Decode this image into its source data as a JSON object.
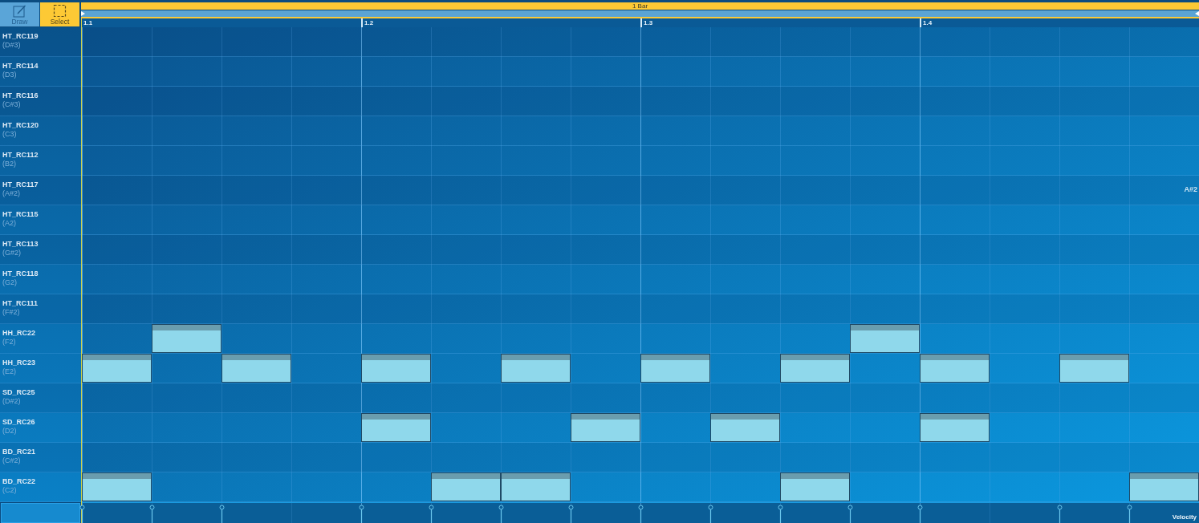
{
  "toolbar": {
    "tools": [
      {
        "kind": "draw",
        "label": "Draw",
        "selected": false
      },
      {
        "kind": "select",
        "label": "Select",
        "selected": true
      }
    ]
  },
  "ruler": {
    "region_label": "1 Bar",
    "markers": [
      "1.1",
      "1.2",
      "1.3",
      "1.4"
    ]
  },
  "rows": [
    {
      "name": "HT_RC119",
      "pitch": "(D#3)",
      "kind": "sharp",
      "steps": [
        {
          "kind": "rest"
        },
        {
          "kind": "rest"
        },
        {
          "kind": "rest"
        },
        {
          "kind": "rest"
        },
        {
          "kind": "rest"
        },
        {
          "kind": "rest"
        },
        {
          "kind": "rest"
        },
        {
          "kind": "rest"
        },
        {
          "kind": "rest"
        },
        {
          "kind": "rest"
        },
        {
          "kind": "rest"
        },
        {
          "kind": "rest"
        },
        {
          "kind": "rest"
        },
        {
          "kind": "rest"
        },
        {
          "kind": "rest"
        },
        {
          "kind": "rest"
        }
      ]
    },
    {
      "name": "HT_RC114",
      "pitch": "(D3)",
      "kind": "natural",
      "steps": [
        {
          "kind": "rest"
        },
        {
          "kind": "rest"
        },
        {
          "kind": "rest"
        },
        {
          "kind": "rest"
        },
        {
          "kind": "rest"
        },
        {
          "kind": "rest"
        },
        {
          "kind": "rest"
        },
        {
          "kind": "rest"
        },
        {
          "kind": "rest"
        },
        {
          "kind": "rest"
        },
        {
          "kind": "rest"
        },
        {
          "kind": "rest"
        },
        {
          "kind": "rest"
        },
        {
          "kind": "rest"
        },
        {
          "kind": "rest"
        },
        {
          "kind": "rest"
        }
      ]
    },
    {
      "name": "HT_RC116",
      "pitch": "(C#3)",
      "kind": "sharp",
      "steps": [
        {
          "kind": "rest"
        },
        {
          "kind": "rest"
        },
        {
          "kind": "rest"
        },
        {
          "kind": "rest"
        },
        {
          "kind": "rest"
        },
        {
          "kind": "rest"
        },
        {
          "kind": "rest"
        },
        {
          "kind": "rest"
        },
        {
          "kind": "rest"
        },
        {
          "kind": "rest"
        },
        {
          "kind": "rest"
        },
        {
          "kind": "rest"
        },
        {
          "kind": "rest"
        },
        {
          "kind": "rest"
        },
        {
          "kind": "rest"
        },
        {
          "kind": "rest"
        }
      ]
    },
    {
      "name": "HT_RC120",
      "pitch": "(C3)",
      "kind": "natural",
      "steps": [
        {
          "kind": "rest"
        },
        {
          "kind": "rest"
        },
        {
          "kind": "rest"
        },
        {
          "kind": "rest"
        },
        {
          "kind": "rest"
        },
        {
          "kind": "rest"
        },
        {
          "kind": "rest"
        },
        {
          "kind": "rest"
        },
        {
          "kind": "rest"
        },
        {
          "kind": "rest"
        },
        {
          "kind": "rest"
        },
        {
          "kind": "rest"
        },
        {
          "kind": "rest"
        },
        {
          "kind": "rest"
        },
        {
          "kind": "rest"
        },
        {
          "kind": "rest"
        }
      ]
    },
    {
      "name": "HT_RC112",
      "pitch": "(B2)",
      "kind": "natural",
      "steps": [
        {
          "kind": "rest"
        },
        {
          "kind": "rest"
        },
        {
          "kind": "rest"
        },
        {
          "kind": "rest"
        },
        {
          "kind": "rest"
        },
        {
          "kind": "rest"
        },
        {
          "kind": "rest"
        },
        {
          "kind": "rest"
        },
        {
          "kind": "rest"
        },
        {
          "kind": "rest"
        },
        {
          "kind": "rest"
        },
        {
          "kind": "rest"
        },
        {
          "kind": "rest"
        },
        {
          "kind": "rest"
        },
        {
          "kind": "rest"
        },
        {
          "kind": "rest"
        }
      ]
    },
    {
      "name": "HT_RC117",
      "pitch": "(A#2)",
      "kind": "sharp",
      "hover_label": "A#2",
      "steps": [
        {
          "kind": "rest"
        },
        {
          "kind": "rest"
        },
        {
          "kind": "rest"
        },
        {
          "kind": "rest"
        },
        {
          "kind": "rest"
        },
        {
          "kind": "rest"
        },
        {
          "kind": "rest"
        },
        {
          "kind": "rest"
        },
        {
          "kind": "rest"
        },
        {
          "kind": "rest"
        },
        {
          "kind": "rest"
        },
        {
          "kind": "rest"
        },
        {
          "kind": "rest"
        },
        {
          "kind": "rest"
        },
        {
          "kind": "rest"
        },
        {
          "kind": "rest"
        }
      ]
    },
    {
      "name": "HT_RC115",
      "pitch": "(A2)",
      "kind": "natural",
      "steps": [
        {
          "kind": "rest"
        },
        {
          "kind": "rest"
        },
        {
          "kind": "rest"
        },
        {
          "kind": "rest"
        },
        {
          "kind": "rest"
        },
        {
          "kind": "rest"
        },
        {
          "kind": "rest"
        },
        {
          "kind": "rest"
        },
        {
          "kind": "rest"
        },
        {
          "kind": "rest"
        },
        {
          "kind": "rest"
        },
        {
          "kind": "rest"
        },
        {
          "kind": "rest"
        },
        {
          "kind": "rest"
        },
        {
          "kind": "rest"
        },
        {
          "kind": "rest"
        }
      ]
    },
    {
      "name": "HT_RC113",
      "pitch": "(G#2)",
      "kind": "sharp",
      "steps": [
        {
          "kind": "rest"
        },
        {
          "kind": "rest"
        },
        {
          "kind": "rest"
        },
        {
          "kind": "rest"
        },
        {
          "kind": "rest"
        },
        {
          "kind": "rest"
        },
        {
          "kind": "rest"
        },
        {
          "kind": "rest"
        },
        {
          "kind": "rest"
        },
        {
          "kind": "rest"
        },
        {
          "kind": "rest"
        },
        {
          "kind": "rest"
        },
        {
          "kind": "rest"
        },
        {
          "kind": "rest"
        },
        {
          "kind": "rest"
        },
        {
          "kind": "rest"
        }
      ]
    },
    {
      "name": "HT_RC118",
      "pitch": "(G2)",
      "kind": "natural",
      "steps": [
        {
          "kind": "rest"
        },
        {
          "kind": "rest"
        },
        {
          "kind": "rest"
        },
        {
          "kind": "rest"
        },
        {
          "kind": "rest"
        },
        {
          "kind": "rest"
        },
        {
          "kind": "rest"
        },
        {
          "kind": "rest"
        },
        {
          "kind": "rest"
        },
        {
          "kind": "rest"
        },
        {
          "kind": "rest"
        },
        {
          "kind": "rest"
        },
        {
          "kind": "rest"
        },
        {
          "kind": "rest"
        },
        {
          "kind": "rest"
        },
        {
          "kind": "rest"
        }
      ]
    },
    {
      "name": "HT_RC111",
      "pitch": "(F#2)",
      "kind": "sharp",
      "steps": [
        {
          "kind": "rest"
        },
        {
          "kind": "rest"
        },
        {
          "kind": "rest"
        },
        {
          "kind": "rest"
        },
        {
          "kind": "rest"
        },
        {
          "kind": "rest"
        },
        {
          "kind": "rest"
        },
        {
          "kind": "rest"
        },
        {
          "kind": "rest"
        },
        {
          "kind": "rest"
        },
        {
          "kind": "rest"
        },
        {
          "kind": "rest"
        },
        {
          "kind": "rest"
        },
        {
          "kind": "rest"
        },
        {
          "kind": "rest"
        },
        {
          "kind": "rest"
        }
      ]
    },
    {
      "name": "HH_RC22",
      "pitch": "(F2)",
      "kind": "natural",
      "steps": [
        {
          "kind": "rest"
        },
        {
          "kind": "note"
        },
        {
          "kind": "rest"
        },
        {
          "kind": "rest"
        },
        {
          "kind": "rest"
        },
        {
          "kind": "rest"
        },
        {
          "kind": "rest"
        },
        {
          "kind": "rest"
        },
        {
          "kind": "rest"
        },
        {
          "kind": "rest"
        },
        {
          "kind": "rest"
        },
        {
          "kind": "note"
        },
        {
          "kind": "rest"
        },
        {
          "kind": "rest"
        },
        {
          "kind": "rest"
        },
        {
          "kind": "rest"
        }
      ]
    },
    {
      "name": "HH_RC23",
      "pitch": "(E2)",
      "kind": "natural",
      "steps": [
        {
          "kind": "note"
        },
        {
          "kind": "rest"
        },
        {
          "kind": "note"
        },
        {
          "kind": "rest"
        },
        {
          "kind": "note"
        },
        {
          "kind": "rest"
        },
        {
          "kind": "note"
        },
        {
          "kind": "rest"
        },
        {
          "kind": "note"
        },
        {
          "kind": "rest"
        },
        {
          "kind": "note"
        },
        {
          "kind": "rest"
        },
        {
          "kind": "note"
        },
        {
          "kind": "rest"
        },
        {
          "kind": "note"
        },
        {
          "kind": "rest"
        }
      ]
    },
    {
      "name": "SD_RC25",
      "pitch": "(D#2)",
      "kind": "sharp",
      "steps": [
        {
          "kind": "rest"
        },
        {
          "kind": "rest"
        },
        {
          "kind": "rest"
        },
        {
          "kind": "rest"
        },
        {
          "kind": "rest"
        },
        {
          "kind": "rest"
        },
        {
          "kind": "rest"
        },
        {
          "kind": "rest"
        },
        {
          "kind": "rest"
        },
        {
          "kind": "rest"
        },
        {
          "kind": "rest"
        },
        {
          "kind": "rest"
        },
        {
          "kind": "rest"
        },
        {
          "kind": "rest"
        },
        {
          "kind": "rest"
        },
        {
          "kind": "rest"
        }
      ]
    },
    {
      "name": "SD_RC26",
      "pitch": "(D2)",
      "kind": "natural",
      "steps": [
        {
          "kind": "rest"
        },
        {
          "kind": "rest"
        },
        {
          "kind": "rest"
        },
        {
          "kind": "rest"
        },
        {
          "kind": "note"
        },
        {
          "kind": "rest"
        },
        {
          "kind": "rest"
        },
        {
          "kind": "note"
        },
        {
          "kind": "rest"
        },
        {
          "kind": "note"
        },
        {
          "kind": "rest"
        },
        {
          "kind": "rest"
        },
        {
          "kind": "note"
        },
        {
          "kind": "rest"
        },
        {
          "kind": "rest"
        },
        {
          "kind": "rest"
        }
      ]
    },
    {
      "name": "BD_RC21",
      "pitch": "(C#2)",
      "kind": "sharp",
      "steps": [
        {
          "kind": "rest"
        },
        {
          "kind": "rest"
        },
        {
          "kind": "rest"
        },
        {
          "kind": "rest"
        },
        {
          "kind": "rest"
        },
        {
          "kind": "rest"
        },
        {
          "kind": "rest"
        },
        {
          "kind": "rest"
        },
        {
          "kind": "rest"
        },
        {
          "kind": "rest"
        },
        {
          "kind": "rest"
        },
        {
          "kind": "rest"
        },
        {
          "kind": "rest"
        },
        {
          "kind": "rest"
        },
        {
          "kind": "rest"
        },
        {
          "kind": "rest"
        }
      ]
    },
    {
      "name": "BD_RC22",
      "pitch": "(C2)",
      "kind": "natural",
      "steps": [
        {
          "kind": "note"
        },
        {
          "kind": "rest"
        },
        {
          "kind": "rest"
        },
        {
          "kind": "rest"
        },
        {
          "kind": "rest"
        },
        {
          "kind": "note"
        },
        {
          "kind": "note"
        },
        {
          "kind": "rest"
        },
        {
          "kind": "rest"
        },
        {
          "kind": "rest"
        },
        {
          "kind": "note"
        },
        {
          "kind": "rest"
        },
        {
          "kind": "rest"
        },
        {
          "kind": "rest"
        },
        {
          "kind": "rest"
        },
        {
          "kind": "note"
        }
      ]
    }
  ],
  "velocity_lane": {
    "label": "Velocity"
  }
}
